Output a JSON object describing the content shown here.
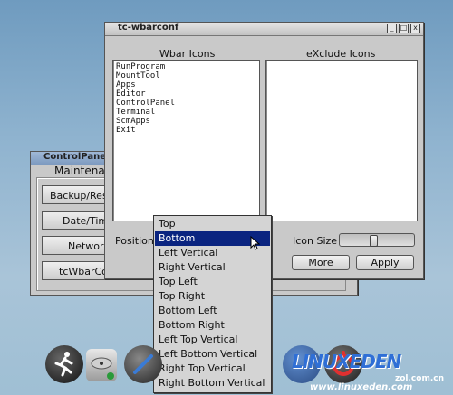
{
  "wbarconf": {
    "title": "tc-wbarconf",
    "buttons": {
      "minimize": "_",
      "maximize": "□",
      "close": "x"
    },
    "wbar_icons_header": "Wbar Icons",
    "exclude_icons_header": "eXclude Icons",
    "wbar_icons": [
      "RunProgram",
      "MountTool",
      "Apps",
      "Editor",
      "ControlPanel",
      "Terminal",
      "ScmApps",
      "Exit"
    ],
    "position_label": "Position",
    "icon_size_label": "Icon Size",
    "icon_size_value": 0.45,
    "more_button": "More",
    "apply_button": "Apply"
  },
  "control_panel": {
    "title": "ControlPanel",
    "heading": "Maintenan",
    "buttons": [
      "Backup/Res",
      "Date/Tim",
      "Network",
      "tcWbarCo"
    ]
  },
  "position_menu": {
    "selected": "Bottom",
    "items": [
      "Top",
      "Bottom",
      "Left Vertical",
      "Right Vertical",
      "Top Left",
      "Top Right",
      "Bottom Left",
      "Bottom Right",
      "Left Top Vertical",
      "Left Bottom Vertical",
      "Right Top Vertical",
      "Right Bottom Vertical"
    ]
  },
  "watermark": {
    "logo": "LINUXEDEN",
    "sub": "zol.com.cn",
    "url": "www.linuxeden.com"
  },
  "colors": {
    "selection": "#0a2480",
    "window_bg": "#c9c9c9"
  }
}
